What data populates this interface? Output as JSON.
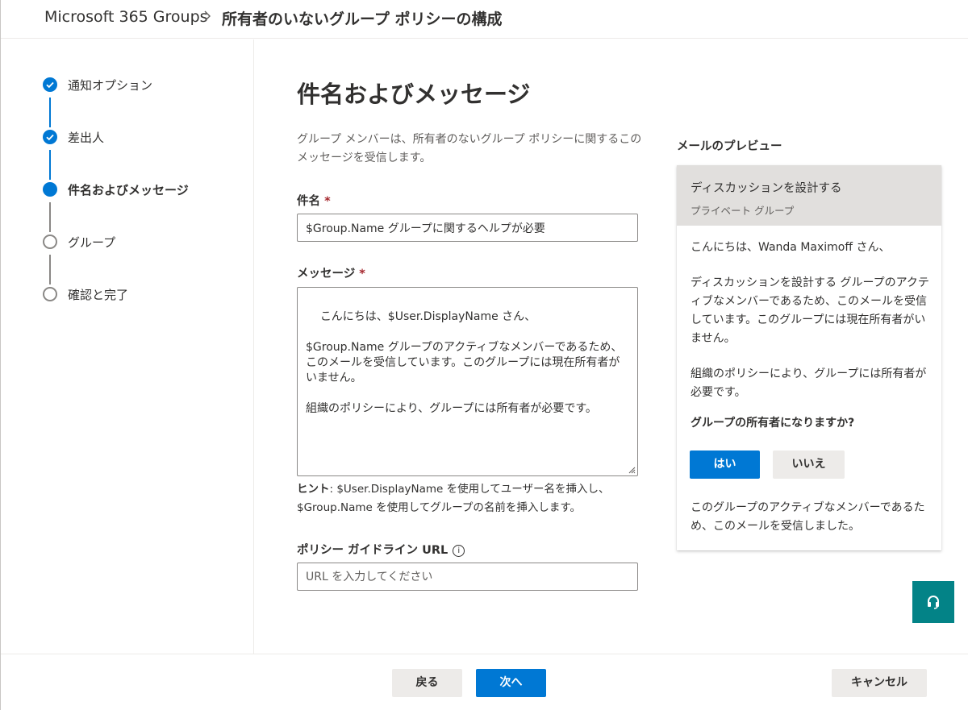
{
  "header": {
    "breadcrumb_root": "Microsoft 365 Groups",
    "breadcrumb_current": "所有者のいないグループ ポリシーの構成"
  },
  "steps": [
    {
      "label": "通知オプション",
      "state": "done"
    },
    {
      "label": "差出人",
      "state": "done"
    },
    {
      "label": "件名およびメッセージ",
      "state": "current"
    },
    {
      "label": "グループ",
      "state": "todo"
    },
    {
      "label": "確認と完了",
      "state": "todo"
    }
  ],
  "main": {
    "title": "件名およびメッセージ",
    "description": "グループ メンバーは、所有者のないグループ ポリシーに関するこのメッセージを受信します。",
    "subject_label": "件名",
    "required_mark": "*",
    "subject_value": "$Group.Name グループに関するヘルプが必要",
    "message_label": "メッセージ",
    "message_value": "こんにちは、$User.DisplayName さん、\n\n$Group.Name グループのアクティブなメンバーであるため、このメールを受信しています。このグループには現在所有者がいません。\n\n組織のポリシーにより、グループには所有者が必要です。",
    "hint_label": "ヒント",
    "hint_text": ": $User.DisplayName を使用してユーザー名を挿入し、$Group.Name を使用してグループの名前を挿入します。",
    "url_label": "ポリシー ガイドライン URL",
    "url_info_icon": "i",
    "url_placeholder": "URL を入力してください"
  },
  "preview": {
    "title": "メールのプレビュー",
    "group_name": "ディスカッションを設計する",
    "group_type": "プライベート グループ",
    "greeting": "こんにちは、Wanda Maximoff さん、",
    "body1": "ディスカッションを設計する グループのアクティブなメンバーであるため、このメールを受信しています。このグループには現在所有者がいません。",
    "body2": "組織のポリシーにより、グループには所有者が必要です。",
    "question": "グループの所有者になりますか?",
    "yes_label": "はい",
    "no_label": "いいえ",
    "footer_text": "このグループのアクティブなメンバーであるため、このメールを受信しました。"
  },
  "footer": {
    "back_label": "戻る",
    "next_label": "次へ",
    "cancel_label": "キャンセル"
  },
  "colors": {
    "accent": "#0078d4",
    "help_button": "#038387",
    "required": "#a4262c"
  },
  "icons": {
    "checkmark": "checkmark-icon",
    "chevron": "chevron-right-icon",
    "help": "headset-icon",
    "info": "info-icon"
  }
}
